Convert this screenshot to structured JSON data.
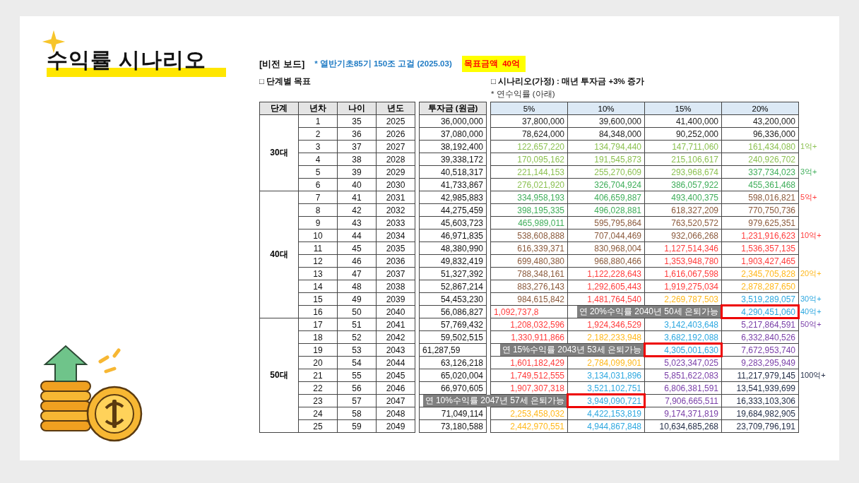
{
  "slide": {
    "title": "수익률 시나리오"
  },
  "header": {
    "board": "[비전 보드]",
    "note": "* 열반기초85기 150조 고걸 (2025.03)",
    "target": "목표금액  40억"
  },
  "section_left": "□ 단계별 목표",
  "section_right": "□ 시나리오(가정) : 매년 투자금 +3% 증가",
  "subnote": "* 연수익률 (아래)",
  "table": {
    "columns": [
      "단계",
      "년차",
      "나이",
      "년도",
      "투자금 (원금)",
      "5%",
      "10%",
      "15%",
      "20%"
    ],
    "groups": [
      {
        "label": "30대",
        "rows": [
          {
            "n": "1",
            "age": "35",
            "year": "2025",
            "invest": {
              "text": "36,000,000"
            },
            "returns": {
              "pct5": {
                "text": "37,800,000",
                "color": "#222222"
              },
              "pct10": {
                "text": "39,600,000",
                "color": "#222222"
              },
              "pct15": {
                "text": "41,400,000",
                "color": "#222222"
              },
              "pct20": {
                "text": "43,200,000",
                "color": "#222222"
              }
            }
          },
          {
            "n": "2",
            "age": "36",
            "year": "2026",
            "invest": {
              "text": "37,080,000"
            },
            "returns": {
              "pct5": {
                "text": "78,624,000",
                "color": "#222222"
              },
              "pct10": {
                "text": "84,348,000",
                "color": "#222222"
              },
              "pct15": {
                "text": "90,252,000",
                "color": "#222222"
              },
              "pct20": {
                "text": "96,336,000",
                "color": "#222222"
              }
            }
          },
          {
            "n": "3",
            "age": "37",
            "year": "2027",
            "invest": {
              "text": "38,192,400"
            },
            "returns": {
              "pct5": {
                "text": "122,657,220",
                "color": "#8cc152"
              },
              "pct10": {
                "text": "134,794,440",
                "color": "#8cc152"
              },
              "pct15": {
                "text": "147,711,060",
                "color": "#8cc152"
              },
              "pct20": {
                "text": "161,434,080",
                "color": "#8cc152"
              }
            },
            "note": {
              "text": "1억+",
              "color": "#8cc152"
            }
          },
          {
            "n": "4",
            "age": "38",
            "year": "2028",
            "invest": {
              "text": "39,338,172"
            },
            "returns": {
              "pct5": {
                "text": "170,095,162",
                "color": "#8cc152"
              },
              "pct10": {
                "text": "191,545,873",
                "color": "#8cc152"
              },
              "pct15": {
                "text": "215,106,617",
                "color": "#8cc152"
              },
              "pct20": {
                "text": "240,926,702",
                "color": "#8cc152"
              }
            }
          },
          {
            "n": "5",
            "age": "39",
            "year": "2029",
            "invest": {
              "text": "40,518,317"
            },
            "returns": {
              "pct5": {
                "text": "221,144,153",
                "color": "#8cc152"
              },
              "pct10": {
                "text": "255,270,609",
                "color": "#8cc152"
              },
              "pct15": {
                "text": "293,968,674",
                "color": "#8cc152"
              },
              "pct20": {
                "text": "337,734,023",
                "color": "#3fae5a"
              }
            },
            "note": {
              "text": "3억+",
              "color": "#3fae5a"
            }
          },
          {
            "n": "6",
            "age": "40",
            "year": "2030",
            "invest": {
              "text": "41,733,867"
            },
            "returns": {
              "pct5": {
                "text": "276,021,920",
                "color": "#8cc152"
              },
              "pct10": {
                "text": "326,704,924",
                "color": "#3fae5a"
              },
              "pct15": {
                "text": "386,057,922",
                "color": "#3fae5a"
              },
              "pct20": {
                "text": "455,361,468",
                "color": "#3fae5a"
              }
            }
          }
        ]
      },
      {
        "label": "40대",
        "rows": [
          {
            "n": "7",
            "age": "41",
            "year": "2031",
            "invest": {
              "text": "42,985,883"
            },
            "returns": {
              "pct5": {
                "text": "334,958,193",
                "color": "#3fae5a"
              },
              "pct10": {
                "text": "406,659,887",
                "color": "#3fae5a"
              },
              "pct15": {
                "text": "493,400,375",
                "color": "#3fae5a"
              },
              "pct20": {
                "text": "598,016,821",
                "color": "#8b5a3c"
              }
            },
            "note": {
              "text": "5억+",
              "color": "#ff3b3b"
            }
          },
          {
            "n": "8",
            "age": "42",
            "year": "2032",
            "invest": {
              "text": "44,275,459"
            },
            "returns": {
              "pct5": {
                "text": "398,195,335",
                "color": "#3fae5a"
              },
              "pct10": {
                "text": "496,028,881",
                "color": "#3fae5a"
              },
              "pct15": {
                "text": "618,327,209",
                "color": "#8b5a3c"
              },
              "pct20": {
                "text": "770,750,736",
                "color": "#8b5a3c"
              }
            }
          },
          {
            "n": "9",
            "age": "43",
            "year": "2033",
            "invest": {
              "text": "45,603,723"
            },
            "returns": {
              "pct5": {
                "text": "465,989,011",
                "color": "#3fae5a"
              },
              "pct10": {
                "text": "595,795,864",
                "color": "#8b5a3c"
              },
              "pct15": {
                "text": "763,520,572",
                "color": "#8b5a3c"
              },
              "pct20": {
                "text": "979,625,351",
                "color": "#8b5a3c"
              }
            }
          },
          {
            "n": "10",
            "age": "44",
            "year": "2034",
            "invest": {
              "text": "46,971,835"
            },
            "returns": {
              "pct5": {
                "text": "538,608,888",
                "color": "#8b5a3c"
              },
              "pct10": {
                "text": "707,044,469",
                "color": "#8b5a3c"
              },
              "pct15": {
                "text": "932,066,268",
                "color": "#8b5a3c"
              },
              "pct20": {
                "text": "1,231,916,623",
                "color": "#ff3b3b"
              }
            },
            "note": {
              "text": "10억+",
              "color": "#ff3b3b"
            }
          },
          {
            "n": "11",
            "age": "45",
            "year": "2035",
            "invest": {
              "text": "48,380,990"
            },
            "returns": {
              "pct5": {
                "text": "616,339,371",
                "color": "#8b5a3c"
              },
              "pct10": {
                "text": "830,968,004",
                "color": "#8b5a3c"
              },
              "pct15": {
                "text": "1,127,514,346",
                "color": "#ff3b3b"
              },
              "pct20": {
                "text": "1,536,357,135",
                "color": "#ff3b3b"
              }
            }
          },
          {
            "n": "12",
            "age": "46",
            "year": "2036",
            "invest": {
              "text": "49,832,419"
            },
            "returns": {
              "pct5": {
                "text": "699,480,380",
                "color": "#8b5a3c"
              },
              "pct10": {
                "text": "968,880,466",
                "color": "#8b5a3c"
              },
              "pct15": {
                "text": "1,353,948,780",
                "color": "#ff3b3b"
              },
              "pct20": {
                "text": "1,903,427,465",
                "color": "#ff3b3b"
              }
            }
          },
          {
            "n": "13",
            "age": "47",
            "year": "2037",
            "invest": {
              "text": "51,327,392"
            },
            "returns": {
              "pct5": {
                "text": "788,348,161",
                "color": "#8b5a3c"
              },
              "pct10": {
                "text": "1,122,228,643",
                "color": "#ff3b3b"
              },
              "pct15": {
                "text": "1,616,067,598",
                "color": "#ff3b3b"
              },
              "pct20": {
                "text": "2,345,705,828",
                "color": "#ffb81c"
              }
            },
            "note": {
              "text": "20억+",
              "color": "#ffb81c"
            }
          },
          {
            "n": "14",
            "age": "48",
            "year": "2038",
            "invest": {
              "text": "52,867,214"
            },
            "returns": {
              "pct5": {
                "text": "883,276,143",
                "color": "#8b5a3c"
              },
              "pct10": {
                "text": "1,292,605,443",
                "color": "#ff3b3b"
              },
              "pct15": {
                "text": "1,919,275,034",
                "color": "#ff3b3b"
              },
              "pct20": {
                "text": "2,878,287,650",
                "color": "#ffb81c"
              }
            }
          },
          {
            "n": "15",
            "age": "49",
            "year": "2039",
            "invest": {
              "text": "54,453,230"
            },
            "returns": {
              "pct5": {
                "text": "984,615,842",
                "color": "#8b5a3c"
              },
              "pct10": {
                "text": "1,481,764,540",
                "color": "#ff3b3b"
              },
              "pct15": {
                "text": "2,269,787,503",
                "color": "#ffb81c"
              },
              "pct20": {
                "text": "3,519,289,057",
                "color": "#2ea8e0"
              }
            },
            "note": {
              "text": "30억+",
              "color": "#2ea8e0"
            }
          },
          {
            "n": "16",
            "age": "50",
            "year": "2040",
            "invest": {
              "text": "56,086,827"
            },
            "returns": {
              "pct5": {
                "text": "1,092,737,8",
                "color": "#ff3b3b",
                "kind": "cut"
              },
              "pct20": {
                "text": "4,290,451,060",
                "color": "#2ea8e0",
                "callout": "연 20%수익률 2040년 50세 은퇴가능"
              }
            },
            "note": {
              "text": "40억+",
              "color": "#2ea8e0"
            }
          }
        ]
      },
      {
        "label": "50대",
        "rows": [
          {
            "n": "17",
            "age": "51",
            "year": "2041",
            "invest": {
              "text": "57,769,432"
            },
            "returns": {
              "pct5": {
                "text": "1,208,032,596",
                "color": "#ff3b3b"
              },
              "pct10": {
                "text": "1,924,346,529",
                "color": "#ff3b3b"
              },
              "pct15": {
                "text": "3,142,403,648",
                "color": "#2ea8e0"
              },
              "pct20": {
                "text": "5,217,864,591",
                "color": "#7a3fa8"
              }
            },
            "note": {
              "text": "50억+",
              "color": "#7a3fa8"
            }
          },
          {
            "n": "18",
            "age": "52",
            "year": "2042",
            "invest": {
              "text": "59,502,515"
            },
            "returns": {
              "pct5": {
                "text": "1,330,911,866",
                "color": "#ff3b3b"
              },
              "pct10": {
                "text": "2,182,233,948",
                "color": "#ffb81c"
              },
              "pct15": {
                "text": "3,682,192,088",
                "color": "#2ea8e0"
              },
              "pct20": {
                "text": "6,332,840,526",
                "color": "#7a3fa8"
              }
            }
          },
          {
            "n": "19",
            "age": "53",
            "year": "2043",
            "invest": {
              "text": "61,287,59",
              "kind": "cut"
            },
            "returns": {
              "pct15": {
                "text": "4,305,001,630",
                "color": "#2ea8e0",
                "callout": "연 15%수익률 2043년 53세 은퇴가능"
              },
              "pct20": {
                "text": "7,672,953,740",
                "color": "#7a3fa8"
              }
            }
          },
          {
            "n": "20",
            "age": "54",
            "year": "2044",
            "invest": {
              "text": "63,126,218"
            },
            "returns": {
              "pct5": {
                "text": "1,601,182,429",
                "color": "#ff3b3b"
              },
              "pct10": {
                "text": "2,784,099,901",
                "color": "#ffb81c"
              },
              "pct15": {
                "text": "5,023,347,025",
                "color": "#7a3fa8"
              },
              "pct20": {
                "text": "9,283,295,949",
                "color": "#7a3fa8"
              }
            }
          },
          {
            "n": "21",
            "age": "55",
            "year": "2045",
            "invest": {
              "text": "65,020,004"
            },
            "returns": {
              "pct5": {
                "text": "1,749,512,555",
                "color": "#ff3b3b"
              },
              "pct10": {
                "text": "3,134,031,896",
                "color": "#2ea8e0"
              },
              "pct15": {
                "text": "5,851,622,083",
                "color": "#7a3fa8"
              },
              "pct20": {
                "text": "11,217,979,145",
                "color": "#1f2a44"
              }
            },
            "note": {
              "text": "100억+",
              "color": "#1f2a44"
            }
          },
          {
            "n": "22",
            "age": "56",
            "year": "2046",
            "invest": {
              "text": "66,970,605"
            },
            "returns": {
              "pct5": {
                "text": "1,907,307,318",
                "color": "#ff3b3b"
              },
              "pct10": {
                "text": "3,521,102,751",
                "color": "#2ea8e0"
              },
              "pct15": {
                "text": "6,806,381,591",
                "color": "#7a3fa8"
              },
              "pct20": {
                "text": "13,541,939,699",
                "color": "#1f2a44"
              }
            }
          },
          {
            "n": "23",
            "age": "57",
            "year": "2047",
            "returns": {
              "pct10": {
                "text": "3,949,090,721",
                "color": "#2ea8e0",
                "callout": "연 10%수익률 2047년 57세 은퇴가능"
              },
              "pct15": {
                "text": "7,906,665,511",
                "color": "#7a3fa8"
              },
              "pct20": {
                "text": "16,333,103,306",
                "color": "#1f2a44"
              }
            }
          },
          {
            "n": "24",
            "age": "58",
            "year": "2048",
            "invest": {
              "text": "71,049,114"
            },
            "returns": {
              "pct5": {
                "text": "2,253,458,032",
                "color": "#ffb81c"
              },
              "pct10": {
                "text": "4,422,153,819",
                "color": "#2ea8e0"
              },
              "pct15": {
                "text": "9,174,371,819",
                "color": "#7a3fa8"
              },
              "pct20": {
                "text": "19,684,982,905",
                "color": "#1f2a44"
              }
            }
          },
          {
            "n": "25",
            "age": "59",
            "year": "2049",
            "invest": {
              "text": "73,180,588"
            },
            "returns": {
              "pct5": {
                "text": "2,442,970,551",
                "color": "#ffb81c"
              },
              "pct10": {
                "text": "4,944,867,848",
                "color": "#2ea8e0"
              },
              "pct15": {
                "text": "10,634,685,268",
                "color": "#1f2a44"
              },
              "pct20": {
                "text": "23,709,796,191",
                "color": "#1f2a44"
              }
            }
          }
        ]
      }
    ]
  }
}
